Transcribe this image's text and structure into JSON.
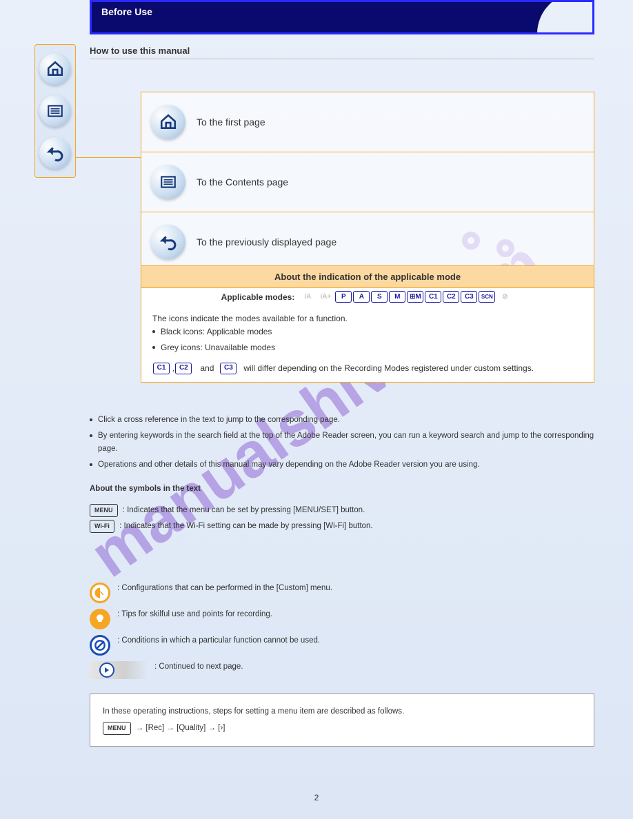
{
  "banner_title": "Before Use",
  "heading": "How to use this manual",
  "nav": {
    "home": "To the first page",
    "toc": "To the Contents page",
    "back": "To the previously displayed page"
  },
  "modes": {
    "title": "About the indication of the applicable mode",
    "sub": "Applicable modes:",
    "icons": [
      "iA",
      "iA+",
      "P",
      "A",
      "S",
      "M",
      "⊞M",
      "C1",
      "C2",
      "C3",
      "SCN",
      "⊘"
    ],
    "body1": "The icons indicate the modes available for a function.",
    "body2": "Black icons: Applicable modes",
    "body3": "Grey icons: Unavailable modes",
    "c_note_pre": "",
    "c_and": "and",
    "c_note": " will differ depending on the Recording Modes registered under custom settings."
  },
  "content": {
    "p1": "Click a cross reference in the text to jump to the corresponding page.",
    "p2": "By entering keywords in the search field at the top of the Adobe Reader screen, you can run a keyword search and jump to the corresponding page.",
    "p3": "Operations and other details of this manual may vary depending on the Adobe Reader version you are using.",
    "symhead": "About the symbols in the text",
    "s1": ": Indicates that the menu can be set by pressing [MENU/SET] button.",
    "s2": ": Indicates that the Wi-Fi setting can be made by pressing [Wi-Fi] button.",
    "s3": ": Configurations that can be performed in the [Custom] menu.",
    "s4": ": Tips for skilful use and points for recording.",
    "s5": ": Conditions in which a particular function cannot be used.",
    "s6": ": Continued to next page."
  },
  "note": {
    "l1": "In these operating instructions, steps for setting a menu item are described as follows.",
    "l2": "→ [Rec] → [Quality] → [›]"
  },
  "pagenum": "2",
  "menu_label": "MENU"
}
